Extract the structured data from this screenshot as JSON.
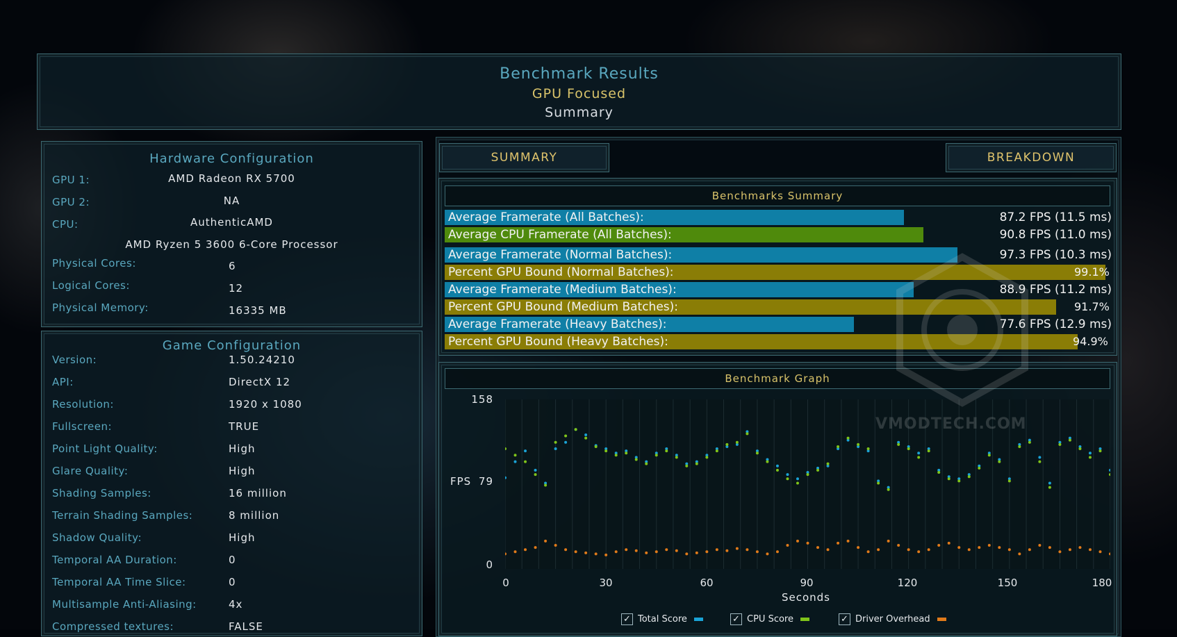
{
  "header": {
    "title": "Benchmark Results",
    "subtitle": "GPU Focused",
    "view": "Summary"
  },
  "hardware": {
    "title": "Hardware Configuration",
    "gpu1_label": "GPU 1:",
    "gpu1_value": "AMD Radeon RX 5700",
    "gpu2_label": "GPU 2:",
    "gpu2_value": "NA",
    "cpu_label": "CPU:",
    "cpu_value": "AuthenticAMD",
    "cpu_name": "AMD Ryzen 5 3600 6-Core Processor",
    "phys_cores_label": "Physical Cores:",
    "phys_cores_value": "6",
    "log_cores_label": "Logical Cores:",
    "log_cores_value": "12",
    "memory_label": "Physical Memory:",
    "memory_value": "16335  MB"
  },
  "game": {
    "title": "Game Configuration",
    "items": [
      {
        "label": "Version:",
        "value": "1.50.24210"
      },
      {
        "label": "API:",
        "value": "DirectX 12"
      },
      {
        "label": "Resolution:",
        "value": "1920 x 1080"
      },
      {
        "label": "Fullscreen:",
        "value": "TRUE"
      },
      {
        "label": "Point Light Quality:",
        "value": "High"
      },
      {
        "label": "Glare Quality:",
        "value": "High"
      },
      {
        "label": "Shading Samples:",
        "value": "16 million"
      },
      {
        "label": "Terrain Shading Samples:",
        "value": "8 million"
      },
      {
        "label": "Shadow Quality:",
        "value": "High"
      },
      {
        "label": "Temporal AA Duration:",
        "value": "0"
      },
      {
        "label": "Temporal AA Time Slice:",
        "value": "0"
      },
      {
        "label": "Multisample Anti-Aliasing:",
        "value": "4x"
      },
      {
        "label": "Compressed textures:",
        "value": "FALSE"
      }
    ]
  },
  "tabs": {
    "summary": "SUMMARY",
    "breakdown": "BREAKDOWN"
  },
  "summary": {
    "title": "Benchmarks Summary",
    "rows": [
      {
        "label": "Average Framerate (All Batches):",
        "value": "87.2 FPS (11.5 ms)",
        "fill": 0.689,
        "color": "#0f7fa6"
      },
      {
        "label": "Average CPU Framerate (All Batches):",
        "value": "90.8 FPS (11.0 ms)",
        "fill": 0.718,
        "color": "#4f8a0c"
      },
      {
        "label": "Average Framerate (Normal Batches):",
        "value": "97.3 FPS (10.3 ms)",
        "fill": 0.769,
        "color": "#0f7fa6"
      },
      {
        "label": "Percent GPU Bound (Normal Batches):",
        "value": "99.1%",
        "fill": 0.991,
        "color": "#8a7d06"
      },
      {
        "label": "Average Framerate (Medium Batches):",
        "value": "88.9 FPS (11.2 ms)",
        "fill": 0.703,
        "color": "#0f7fa6"
      },
      {
        "label": "Percent GPU Bound (Medium Batches):",
        "value": "91.7%",
        "fill": 0.917,
        "color": "#8a7d06"
      },
      {
        "label": "Average Framerate (Heavy Batches):",
        "value": "77.6 FPS (12.9 ms)",
        "fill": 0.614,
        "color": "#0f7fa6"
      },
      {
        "label": "Percent GPU Bound (Heavy Batches):",
        "value": "94.9%",
        "fill": 0.949,
        "color": "#8a7d06"
      }
    ]
  },
  "graph": {
    "title": "Benchmark Graph",
    "watermark": "VMODTECH.COM"
  },
  "chart_data": {
    "type": "scatter",
    "title": "Benchmark Graph",
    "xlabel": "Seconds",
    "ylabel": "FPS",
    "xlim": [
      0,
      180
    ],
    "ylim": [
      0,
      158
    ],
    "x_ticks": [
      "0",
      "30",
      "60",
      "90",
      "120",
      "150",
      "180"
    ],
    "y_ticks": [
      "158",
      "79",
      "0"
    ],
    "legend_placement": "bottom",
    "series": [
      {
        "name": "Total Score",
        "color": "#1aa3d6",
        "x": [
          0,
          3,
          6,
          9,
          12,
          15,
          18,
          21,
          24,
          27,
          30,
          33,
          36,
          39,
          42,
          45,
          48,
          51,
          54,
          57,
          60,
          63,
          66,
          69,
          72,
          75,
          78,
          81,
          84,
          87,
          90,
          93,
          96,
          99,
          102,
          105,
          108,
          111,
          114,
          117,
          120,
          123,
          126,
          129,
          132,
          135,
          138,
          141,
          144,
          147,
          150,
          153,
          156,
          159,
          162,
          165,
          168,
          171,
          174,
          177,
          180
        ],
        "y": [
          85,
          100,
          110,
          92,
          80,
          112,
          118,
          130,
          125,
          115,
          112,
          108,
          110,
          104,
          100,
          108,
          112,
          106,
          98,
          100,
          106,
          112,
          114,
          116,
          128,
          110,
          102,
          96,
          88,
          84,
          90,
          94,
          96,
          112,
          120,
          114,
          110,
          82,
          76,
          118,
          114,
          108,
          112,
          92,
          86,
          84,
          88,
          96,
          108,
          102,
          84,
          116,
          120,
          104,
          80,
          118,
          122,
          114,
          108,
          112,
          92
        ]
      },
      {
        "name": "CPU Score",
        "color": "#7fc41a",
        "x": [
          0,
          3,
          6,
          9,
          12,
          15,
          18,
          21,
          24,
          27,
          30,
          33,
          36,
          39,
          42,
          45,
          48,
          51,
          54,
          57,
          60,
          63,
          66,
          69,
          72,
          75,
          78,
          81,
          84,
          87,
          90,
          93,
          96,
          99,
          102,
          105,
          108,
          111,
          114,
          117,
          120,
          123,
          126,
          129,
          132,
          135,
          138,
          141,
          144,
          147,
          150,
          153,
          156,
          159,
          162,
          165,
          168,
          171,
          174,
          177,
          180
        ],
        "y": [
          112,
          106,
          100,
          88,
          78,
          118,
          124,
          130,
          122,
          114,
          110,
          106,
          108,
          102,
          98,
          106,
          110,
          104,
          96,
          98,
          104,
          110,
          116,
          118,
          126,
          108,
          100,
          92,
          84,
          80,
          88,
          92,
          98,
          114,
          122,
          116,
          112,
          80,
          74,
          116,
          112,
          104,
          110,
          90,
          84,
          82,
          86,
          94,
          106,
          100,
          82,
          114,
          118,
          100,
          76,
          116,
          120,
          112,
          104,
          110,
          88
        ]
      },
      {
        "name": "Driver Overhead",
        "color": "#e07a1a",
        "x": [
          0,
          3,
          6,
          9,
          12,
          15,
          18,
          21,
          24,
          27,
          30,
          33,
          36,
          39,
          42,
          45,
          48,
          51,
          54,
          57,
          60,
          63,
          66,
          69,
          72,
          75,
          78,
          81,
          84,
          87,
          90,
          93,
          96,
          99,
          102,
          105,
          108,
          111,
          114,
          117,
          120,
          123,
          126,
          129,
          132,
          135,
          138,
          141,
          144,
          147,
          150,
          153,
          156,
          159,
          162,
          165,
          168,
          171,
          174,
          177,
          180
        ],
        "y": [
          14,
          16,
          18,
          20,
          26,
          22,
          18,
          16,
          15,
          14,
          13,
          16,
          18,
          17,
          15,
          16,
          18,
          17,
          14,
          15,
          16,
          18,
          17,
          19,
          18,
          16,
          14,
          16,
          22,
          26,
          24,
          20,
          18,
          24,
          26,
          20,
          16,
          18,
          26,
          22,
          18,
          16,
          18,
          22,
          24,
          20,
          18,
          20,
          22,
          20,
          18,
          14,
          18,
          22,
          20,
          16,
          18,
          20,
          18,
          16,
          14
        ]
      }
    ]
  }
}
